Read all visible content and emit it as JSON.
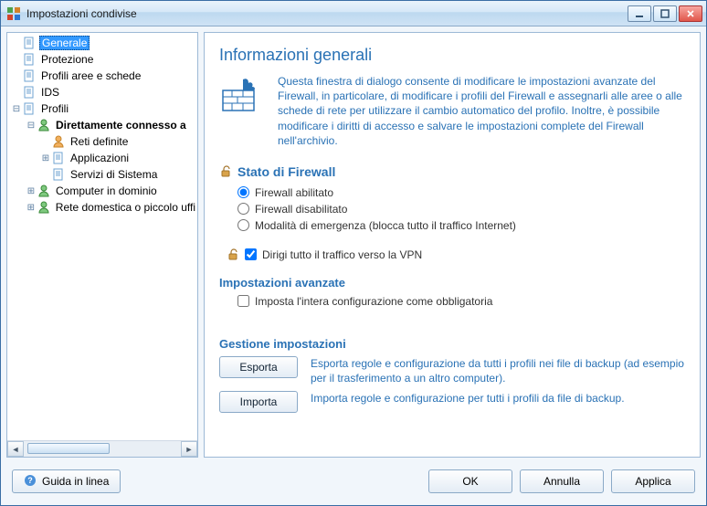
{
  "window": {
    "title": "Impostazioni condivise"
  },
  "tree": {
    "items": [
      {
        "label": "Generale",
        "depth": 0,
        "icon": "doc",
        "twist": "",
        "selected": true
      },
      {
        "label": "Protezione",
        "depth": 0,
        "icon": "doc",
        "twist": ""
      },
      {
        "label": "Profili aree e schede",
        "depth": 0,
        "icon": "doc",
        "twist": ""
      },
      {
        "label": "IDS",
        "depth": 0,
        "icon": "doc",
        "twist": ""
      },
      {
        "label": "Profili",
        "depth": 0,
        "icon": "doc",
        "twist": "minus"
      },
      {
        "label": "Direttamente connesso a",
        "depth": 1,
        "icon": "user",
        "twist": "minus",
        "bold": true
      },
      {
        "label": "Reti definite",
        "depth": 2,
        "icon": "user-orange",
        "twist": ""
      },
      {
        "label": "Applicazioni",
        "depth": 2,
        "icon": "doc",
        "twist": "plus"
      },
      {
        "label": "Servizi di Sistema",
        "depth": 2,
        "icon": "doc",
        "twist": ""
      },
      {
        "label": "Computer in dominio",
        "depth": 1,
        "icon": "user",
        "twist": "plus"
      },
      {
        "label": "Rete domestica o piccolo uffi",
        "depth": 1,
        "icon": "user",
        "twist": "plus"
      }
    ]
  },
  "content": {
    "title": "Informazioni generali",
    "intro": "Questa finestra di dialogo consente di modificare le impostazioni avanzate del Firewall, in particolare, di modificare i profili del Firewall e assegnarli alle aree o alle schede di rete per utilizzare il cambio automatico del profilo. Inoltre, è possibile modificare i diritti di accesso e salvare le impostazioni complete del Firewall nell'archivio.",
    "status_head": "Stato di Firewall",
    "radios": {
      "enabled": "Firewall abilitato",
      "disabled": "Firewall disabilitato",
      "emergency": "Modalità di emergenza (blocca tutto il traffico Internet)"
    },
    "vpn_check": "Dirigi tutto il traffico verso la VPN",
    "adv_head": "Impostazioni avanzate",
    "adv_check": "Imposta l'intera configurazione come obbligatoria",
    "mgmt_head": "Gestione impostazioni",
    "export_btn": "Esporta",
    "export_text": "Esporta regole e configurazione da tutti i profili nei file di backup (ad esempio per il trasferimento a un altro computer).",
    "import_btn": "Importa",
    "import_text": "Importa regole e configurazione per tutti i profili da file di backup."
  },
  "footer": {
    "help": "Guida in linea",
    "ok": "OK",
    "cancel": "Annulla",
    "apply": "Applica"
  }
}
